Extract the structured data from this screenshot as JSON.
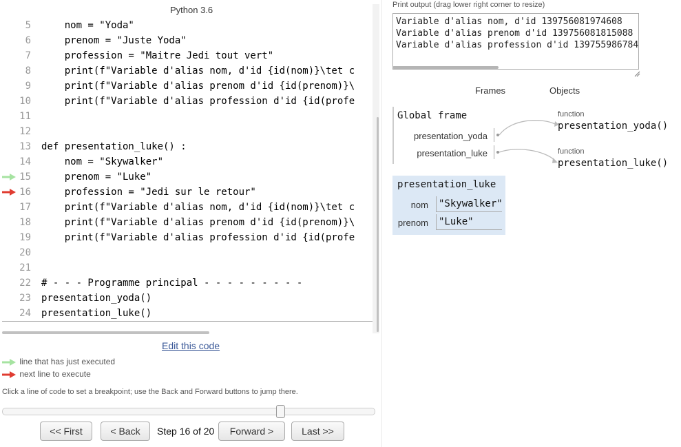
{
  "header": {
    "language": "Python 3.6"
  },
  "code": {
    "lines": [
      {
        "num": "5",
        "text": "    nom = \"Yoda\"",
        "marker": ""
      },
      {
        "num": "6",
        "text": "    prenom = \"Juste Yoda\"",
        "marker": ""
      },
      {
        "num": "7",
        "text": "    profession = \"Maitre Jedi tout vert\"",
        "marker": ""
      },
      {
        "num": "8",
        "text": "    print(f\"Variable d'alias nom, d'id {id(nom)}\\tet c",
        "marker": ""
      },
      {
        "num": "9",
        "text": "    print(f\"Variable d'alias prenom d'id {id(prenom)}\\",
        "marker": ""
      },
      {
        "num": "10",
        "text": "    print(f\"Variable d'alias profession d'id {id(profe",
        "marker": ""
      },
      {
        "num": "11",
        "text": "",
        "marker": ""
      },
      {
        "num": "12",
        "text": "",
        "marker": ""
      },
      {
        "num": "13",
        "text": "def presentation_luke() :",
        "marker": ""
      },
      {
        "num": "14",
        "text": "    nom = \"Skywalker\"",
        "marker": ""
      },
      {
        "num": "15",
        "text": "    prenom = \"Luke\"",
        "marker": "green"
      },
      {
        "num": "16",
        "text": "    profession = \"Jedi sur le retour\"",
        "marker": "red"
      },
      {
        "num": "17",
        "text": "    print(f\"Variable d'alias nom, d'id {id(nom)}\\tet c",
        "marker": ""
      },
      {
        "num": "18",
        "text": "    print(f\"Variable d'alias prenom d'id {id(prenom)}\\",
        "marker": ""
      },
      {
        "num": "19",
        "text": "    print(f\"Variable d'alias profession d'id {id(profe",
        "marker": ""
      },
      {
        "num": "20",
        "text": "",
        "marker": ""
      },
      {
        "num": "21",
        "text": "",
        "marker": ""
      },
      {
        "num": "22",
        "text": "# - - - Programme principal - - - - - - - - -",
        "marker": ""
      },
      {
        "num": "23",
        "text": "presentation_yoda()",
        "marker": ""
      },
      {
        "num": "24",
        "text": "presentation_luke()",
        "marker": ""
      }
    ]
  },
  "edit_link": "Edit this code",
  "legend": {
    "executed": "line that has just executed",
    "next": "next line to execute",
    "executed_color": "#a6e3a1",
    "next_color": "#e03c31"
  },
  "help_text": "Click a line of code to set a breakpoint; use the Back and Forward buttons to jump there.",
  "navigation": {
    "first": "<< First",
    "back": "< Back",
    "step": "Step 16 of 20",
    "forward": "Forward >",
    "last": "Last >>",
    "current_step": 16,
    "total_steps": 20
  },
  "output": {
    "title": "Print output (drag lower right corner to resize)",
    "lines": [
      "Variable d'alias nom, d'id 139756081974608",
      "Variable d'alias prenom d'id 139756081815088",
      "Variable d'alias profession d'id 139755986784"
    ]
  },
  "viz": {
    "frames_header": "Frames",
    "objects_header": "Objects",
    "global_frame": {
      "title": "Global frame",
      "vars": [
        "presentation_yoda",
        "presentation_luke"
      ]
    },
    "objects": [
      {
        "kind": "function",
        "name": "presentation_yoda()"
      },
      {
        "kind": "function",
        "name": "presentation_luke()"
      }
    ],
    "local_frame": {
      "title": "presentation_luke",
      "vars": [
        {
          "name": "nom",
          "value": "\"Skywalker\""
        },
        {
          "name": "prenom",
          "value": "\"Luke\""
        }
      ],
      "bg_color": "#dce8f5"
    }
  }
}
